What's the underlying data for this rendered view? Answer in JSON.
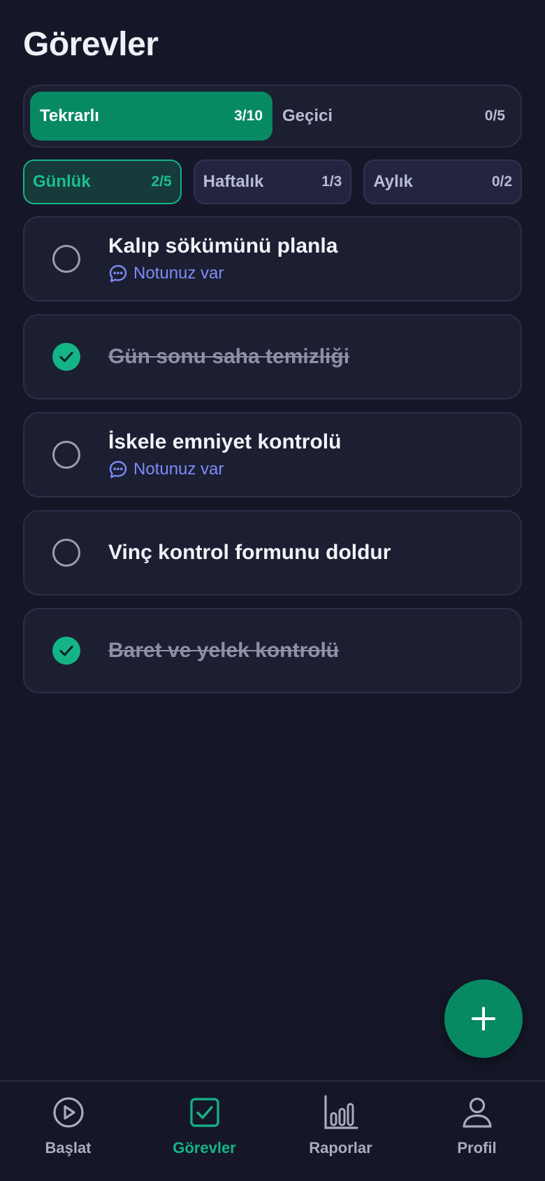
{
  "header": {
    "title": "Görevler"
  },
  "segment": {
    "items": [
      {
        "label": "Tekrarlı",
        "count": "3/10",
        "active": true
      },
      {
        "label": "Geçici",
        "count": "0/5",
        "active": false
      }
    ]
  },
  "period_tabs": [
    {
      "label": "Günlük",
      "count": "2/5",
      "active": true
    },
    {
      "label": "Haftalık",
      "count": "1/3",
      "active": false
    },
    {
      "label": "Aylık",
      "count": "0/2",
      "active": false
    }
  ],
  "tasks": [
    {
      "title": "Kalıp sökümünü planla",
      "done": false,
      "note": "Notunuz var"
    },
    {
      "title": "Gün sonu saha temizliği",
      "done": true,
      "note": null
    },
    {
      "title": "İskele emniyet kontrolü",
      "done": false,
      "note": "Notunuz var"
    },
    {
      "title": "Vinç kontrol formunu doldur",
      "done": false,
      "note": null
    },
    {
      "title": "Baret ve yelek kontrolü",
      "done": true,
      "note": null
    }
  ],
  "fab": {
    "icon": "plus-icon"
  },
  "bottom_nav": [
    {
      "label": "Başlat",
      "icon": "play-circle-icon",
      "active": false
    },
    {
      "label": "Görevler",
      "icon": "checkbox-icon",
      "active": true
    },
    {
      "label": "Raporlar",
      "icon": "bar-chart-icon",
      "active": false
    },
    {
      "label": "Profil",
      "icon": "user-icon",
      "active": false
    }
  ],
  "colors": {
    "background": "#151728",
    "card": "#1c1e32",
    "accent": "#078a64",
    "accent_text": "#14b487",
    "note": "#7d8cf6"
  }
}
